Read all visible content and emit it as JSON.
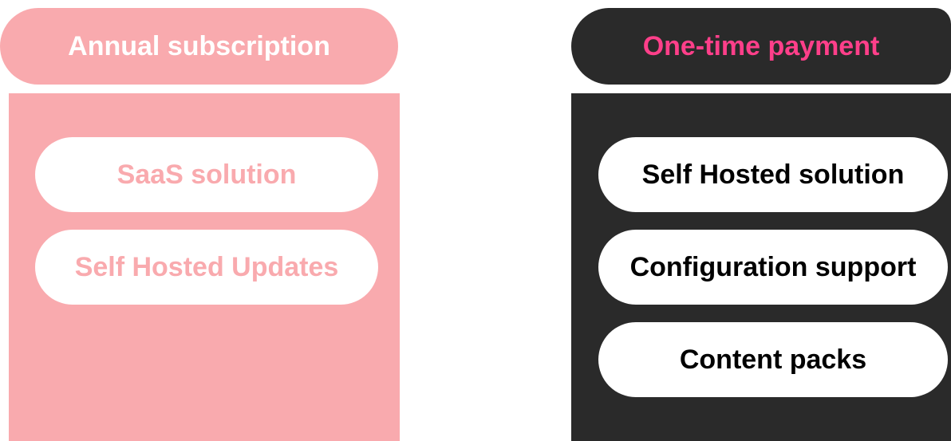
{
  "columns": [
    {
      "title": "Annual subscription",
      "items": [
        "SaaS solution",
        "Self Hosted Updates"
      ],
      "colors": {
        "background": "#f9aaae",
        "title_text": "#ffffff",
        "item_text": "#f9aaae"
      }
    },
    {
      "title": "One-time payment",
      "items": [
        "Self Hosted solution",
        "Configuration support",
        "Content packs"
      ],
      "colors": {
        "background": "#2a2a2a",
        "title_text": "#ff3f8a",
        "item_text": "#000000"
      }
    }
  ]
}
